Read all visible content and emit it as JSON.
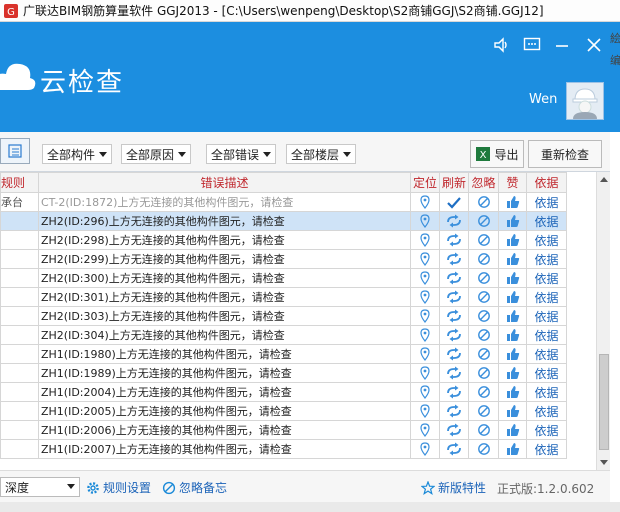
{
  "window": {
    "title": "广联达BIM钢筋算量软件 GGJ2013 - [C:\\Users\\wenpeng\\Desktop\\S2商铺GGJ\\S2商铺.GGJ12]"
  },
  "header": {
    "brand": "云检查",
    "user_name": "Wen",
    "side_text_1": "絵",
    "side_text_2": "编"
  },
  "toolbar": {
    "filters": [
      {
        "label": "全部构件"
      },
      {
        "label": "全部原因"
      },
      {
        "label": "全部错误"
      },
      {
        "label": "全部楼层"
      }
    ],
    "export_label": "导出",
    "recheck_label": "重新检查"
  },
  "table": {
    "columns": [
      "规则",
      "错误描述",
      "定位",
      "刷新",
      "忽略",
      "赞",
      "依据"
    ],
    "rows": [
      {
        "rule": "承台",
        "desc": "CT-2(ID:1872)上方无连接的其他构件图元，请检查",
        "basis": "依据",
        "state": "disabled"
      },
      {
        "rule": "",
        "desc": "ZH2(ID:296)上方无连接的其他构件图元，请检查",
        "basis": "依据",
        "state": "selected"
      },
      {
        "rule": "",
        "desc": "ZH2(ID:298)上方无连接的其他构件图元，请检查",
        "basis": "依据",
        "state": "normal"
      },
      {
        "rule": "",
        "desc": "ZH2(ID:299)上方无连接的其他构件图元，请检查",
        "basis": "依据",
        "state": "normal"
      },
      {
        "rule": "",
        "desc": "ZH2(ID:300)上方无连接的其他构件图元，请检查",
        "basis": "依据",
        "state": "normal"
      },
      {
        "rule": "",
        "desc": "ZH2(ID:301)上方无连接的其他构件图元，请检查",
        "basis": "依据",
        "state": "normal"
      },
      {
        "rule": "",
        "desc": "ZH2(ID:303)上方无连接的其他构件图元，请检查",
        "basis": "依据",
        "state": "normal"
      },
      {
        "rule": "",
        "desc": "ZH2(ID:304)上方无连接的其他构件图元，请检查",
        "basis": "依据",
        "state": "normal"
      },
      {
        "rule": "",
        "desc": "ZH1(ID:1980)上方无连接的其他构件图元，请检查",
        "basis": "依据",
        "state": "normal"
      },
      {
        "rule": "",
        "desc": "ZH1(ID:1989)上方无连接的其他构件图元，请检查",
        "basis": "依据",
        "state": "normal"
      },
      {
        "rule": "",
        "desc": "ZH1(ID:2004)上方无连接的其他构件图元，请检查",
        "basis": "依据",
        "state": "normal"
      },
      {
        "rule": "",
        "desc": "ZH1(ID:2005)上方无连接的其他构件图元，请检查",
        "basis": "依据",
        "state": "normal"
      },
      {
        "rule": "",
        "desc": "ZH1(ID:2006)上方无连接的其他构件图元，请检查",
        "basis": "依据",
        "state": "normal"
      },
      {
        "rule": "",
        "desc": "ZH1(ID:2007)上方无连接的其他构件图元，请检查",
        "basis": "依据",
        "state": "normal"
      }
    ]
  },
  "statusbar": {
    "depth_label": "深度",
    "rule_settings_label": "规则设置",
    "ignore_notes_label": "忽略备忘",
    "new_features_label": "新版特性",
    "version_label": "正式版:1.2.0.602"
  },
  "colors": {
    "header_blue": "#1c8ee0",
    "column_header_red": "#c0272d",
    "link_blue": "#1b63b8",
    "selected_row": "#cfe3f7"
  }
}
